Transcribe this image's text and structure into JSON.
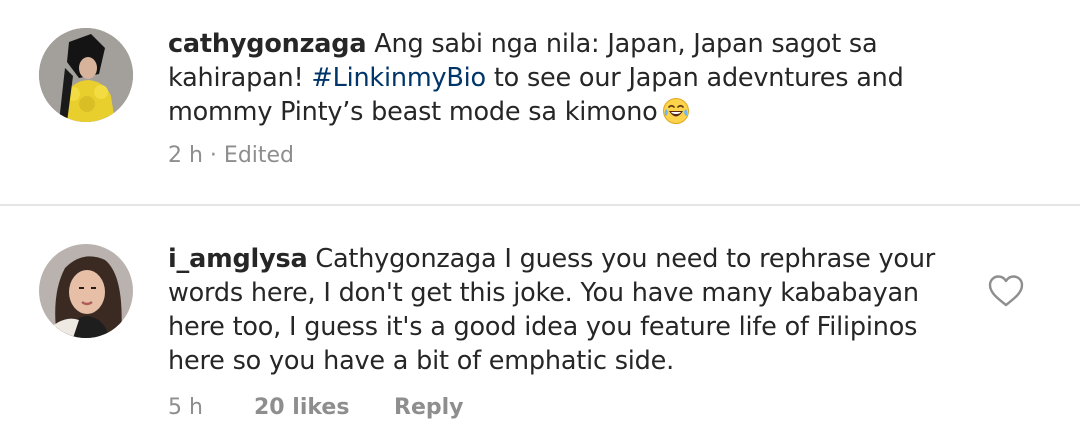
{
  "caption": {
    "username": "cathygonzaga",
    "line1_rest": " Ang sabi nga nila: Japan, Japan sagot sa",
    "line2_start": "kahirapan! ",
    "hashtag": "#LinkinmyBio",
    "line2_rest": " to see our Japan adevntures and",
    "line3": "mommy Pinty’s beast mode sa kimono",
    "emoji_icon": "laughing-tears-emoji",
    "time": "2 h",
    "separator": " · ",
    "edited": "Edited"
  },
  "comment": {
    "username": "i_amglysa",
    "line1_rest": " Cathygonzaga I guess you need to rephrase your",
    "line2": "words here, I don't get this joke. You have many kababayan",
    "line3": "here too, I guess  it's a good idea you feature life of Filipinos",
    "line4": "here so you have a bit of emphatic side.",
    "time": "5 h",
    "likes": "20 likes",
    "reply": "Reply",
    "like_icon": "heart-outline-icon"
  },
  "colors": {
    "text": "#262626",
    "muted": "#8e8e8e",
    "hashtag": "#003569",
    "divider": "#e6e6e6"
  }
}
